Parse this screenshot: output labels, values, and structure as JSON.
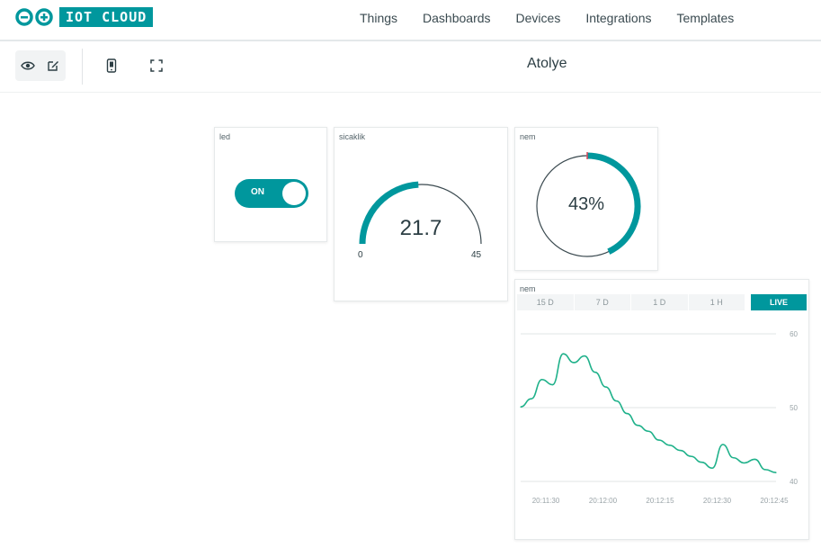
{
  "header": {
    "brand": "IOT CLOUD",
    "nav": [
      {
        "label": "Things"
      },
      {
        "label": "Dashboards"
      },
      {
        "label": "Devices"
      },
      {
        "label": "Integrations"
      },
      {
        "label": "Templates"
      }
    ]
  },
  "toolbar": {
    "dashboard_title": "Atolye",
    "icons": [
      "eye-icon",
      "edit-icon",
      "mobile-icon",
      "fullscreen-icon"
    ]
  },
  "widgets": {
    "led": {
      "label": "led",
      "state": "ON"
    },
    "sicaklik": {
      "label": "sicaklik",
      "value": "21.7",
      "min": "0",
      "max": "45",
      "fraction": 0.482
    },
    "nem_gauge": {
      "label": "nem",
      "value": "43%",
      "fraction": 0.43
    },
    "nem_chart": {
      "label": "nem",
      "ranges": [
        "15 D",
        "7 D",
        "1 D",
        "1 H"
      ],
      "live_label": "LIVE"
    }
  },
  "chart_data": {
    "type": "line",
    "y_ticks": [
      "60",
      "50",
      "40"
    ],
    "ylim": [
      40,
      60
    ],
    "x_ticks": [
      "20:11:30",
      "20:12:00",
      "20:12:15",
      "20:12:30",
      "20:12:45"
    ],
    "series": [
      {
        "values": [
          50.1,
          51.2,
          53.8,
          53.1,
          57.3,
          56.1,
          57.0,
          54.8,
          52.8,
          50.9,
          49.2,
          47.6,
          46.8,
          45.6,
          44.9,
          44.2,
          43.4,
          42.6,
          41.8,
          45.0,
          43.2,
          42.5,
          43.0,
          41.6,
          41.2
        ]
      }
    ],
    "colors": {
      "line": "#1fb18a",
      "grid": "#e1e5e6"
    }
  },
  "colors": {
    "accent": "#00979d"
  }
}
